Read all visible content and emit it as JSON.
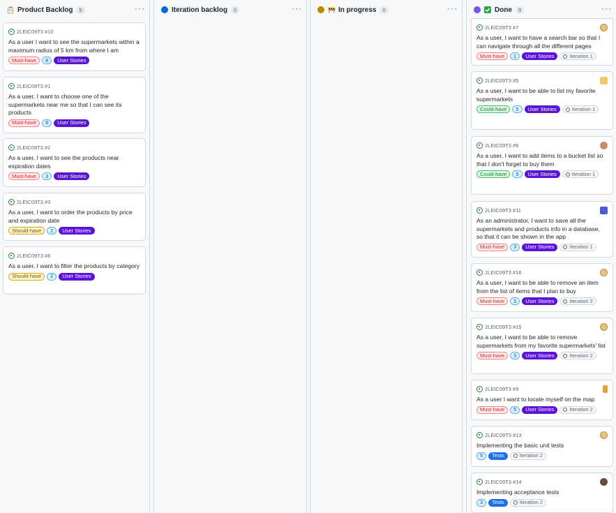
{
  "columns": [
    {
      "title": "Product Backlog",
      "count": "5",
      "icon": "clipboard-icon",
      "more": "···"
    },
    {
      "title": "Iteration backlog",
      "count": "0",
      "icon": "blue-circle-icon",
      "more": "···"
    },
    {
      "title": "In progress",
      "count": "0",
      "icon": "construction-icon",
      "more": "···"
    },
    {
      "title": "Done",
      "count": "9",
      "icon": "check-box-icon",
      "more": "···"
    }
  ],
  "colors": {
    "iteration_dot": "#0969da",
    "progress_dot": "#bf8700",
    "done_dot": "#8250df",
    "check_green": "#2da44e"
  },
  "backlog_cards": [
    {
      "ref": "2LEIC09T3 #10",
      "title": "As a user I want to see the supermarkets within a maximum radius of 5 km from where I am",
      "priority": "Must-have",
      "points": "8",
      "type": "User Stories"
    },
    {
      "ref": "2LEIC09T3 #1",
      "title": "As a user, I want to choose one of the supermarkets near me so that I can see its products",
      "priority": "Must-have",
      "points": "8",
      "type": "User Stories"
    },
    {
      "ref": "2LEIC09T3 #2",
      "title": "As a user, I want to see the products near expiration dates",
      "priority": "Must-have",
      "points": "3",
      "type": "User Stories"
    },
    {
      "ref": "2LEIC09T3 #3",
      "title": "As a user, I want to order the products by price and expiration date",
      "priority": "Should-have",
      "points": "2",
      "type": "User Stories"
    },
    {
      "ref": "2LEIC09T3 #8",
      "title": "As a user, I want to filter the products by category",
      "priority": "Should-have",
      "points": "2",
      "type": "User Stories"
    }
  ],
  "done_cards": [
    {
      "ref": "2LEIC09T3 #7",
      "title": "As a user, I want to have a search bar so that I can navigate through all the different pages",
      "priority": "Must-have",
      "points": "1",
      "type": "User Stories",
      "iteration": "Iteration 1"
    },
    {
      "ref": "2LEIC09T3 #5",
      "title": "As a user, I want to be able to list my favorite supermarkets",
      "priority": "Could-have",
      "points": "5",
      "type": "User Stories",
      "iteration": "Iteration 1"
    },
    {
      "ref": "2LEIC09T3 #6",
      "title": "As a user, I want to add items to a bucket list so that I don't forget to buy them",
      "priority": "Could-have",
      "points": "5",
      "type": "User Stories",
      "iteration": "Iteration 1"
    },
    {
      "ref": "2LEIC09T3 #11",
      "title": "As an administrator, I want to save all the supermarkets and products info in a database, so that it can be shown in the app",
      "priority": "Must-have",
      "points": "3",
      "type": "User Stories",
      "iteration": "Iteration 1"
    },
    {
      "ref": "2LEIC09T3 #16",
      "title": "As a user, I want to be able to remove an item from the list of items that I plan to buy",
      "priority": "Must-have",
      "points": "3",
      "type": "User Stories",
      "iteration": "Iteration 2"
    },
    {
      "ref": "2LEIC09T3 #15",
      "title": "As a user, I want to be able to remove supermarkets from my favorite supermarkets' list",
      "priority": "Must-have",
      "points": "3",
      "type": "User Stories",
      "iteration": "Iteration 2"
    },
    {
      "ref": "2LEIC09T3 #9",
      "title": "As a user I want to locate myself on the map",
      "priority": "Must-have",
      "points": "5",
      "type": "User Stories",
      "iteration": "Iteration 2"
    },
    {
      "ref": "2LEIC09T3 #13",
      "title": "Implementing the basic unit tests",
      "points": "5",
      "type": "Tests",
      "iteration": "Iteration 2"
    },
    {
      "ref": "2LEIC09T3 #14",
      "title": "Implementing acceptance tests",
      "points": "3",
      "type": "Tests",
      "iteration": "Iteration 2"
    }
  ]
}
